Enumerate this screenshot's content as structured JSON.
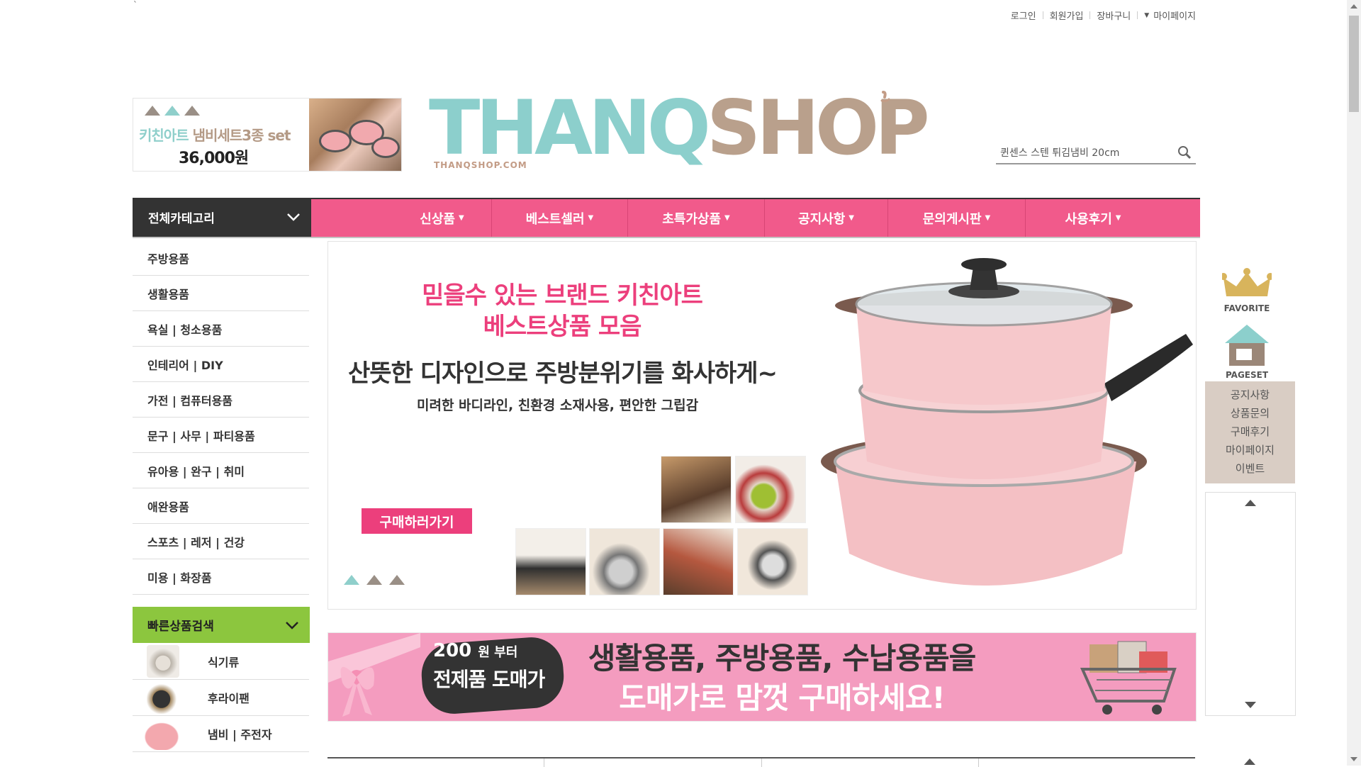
{
  "stray_mark": "`",
  "top_links": {
    "login": "로그인",
    "join": "회원가입",
    "cart": "장바구니",
    "mypage": "마이페이지"
  },
  "promo": {
    "line1_a": "키친아트",
    "line1_b": "냄비세트3종 set",
    "price": "36,000원"
  },
  "logo": {
    "part_a": "THANQ",
    "part_b": "SHOP",
    "sub": "THANQSHOP.COM"
  },
  "search": {
    "value": "퀸센스 스텐 튀김냄비 20cm"
  },
  "nav": {
    "category_label": "전체카테고리",
    "items": [
      {
        "label": "신상품"
      },
      {
        "label": "베스트셀러"
      },
      {
        "label": "초특가상품"
      },
      {
        "label": "공지사항"
      },
      {
        "label": "문의게시판"
      },
      {
        "label": "사용후기"
      }
    ]
  },
  "categories": [
    "주방용품",
    "생활용품",
    "욕실 | 청소용품",
    "인테리어 | DIY",
    "가전 | 컴퓨터용품",
    "문구 | 사무 | 파티용품",
    "유아용 | 완구 | 취미",
    "애완용품",
    "스포츠 | 레저 | 건강",
    "미용 | 화장품"
  ],
  "quick_search": {
    "title": "빠른상품검색",
    "items": [
      "식기류",
      "후라이팬",
      "냄비 | 주전자"
    ]
  },
  "hero": {
    "headline_1": "믿을수 있는 브랜드 키친아트",
    "headline_2": "베스트상품 모음",
    "sub_1": "산뜻한 디자인으로 주방분위기를 화사하게~",
    "sub_2": "미려한 바디라인, 친환경 소재사용, 편안한 그립감",
    "buy_button": "구매하러가기"
  },
  "wholesale_banner": {
    "price_num": "200",
    "price_suffix": "원 부터",
    "badge": "전제품 도매가",
    "main_1": "생활용품, 주방용품, 수납용품을",
    "main_2": "도매가로 맘껏 구매하세요!"
  },
  "right_menu": {
    "favorite": "FAVORITE",
    "pageset": "PAGESET",
    "links": [
      "공지사항",
      "상품문의",
      "구매후기",
      "마이페이지",
      "이벤트"
    ]
  },
  "colors": {
    "nav_pink": "#f15a8b",
    "hero_pink": "#ec3f7c",
    "logo_teal": "#8ccfcc",
    "logo_brown": "#b9a08c",
    "quick_green": "#8cc63e"
  }
}
